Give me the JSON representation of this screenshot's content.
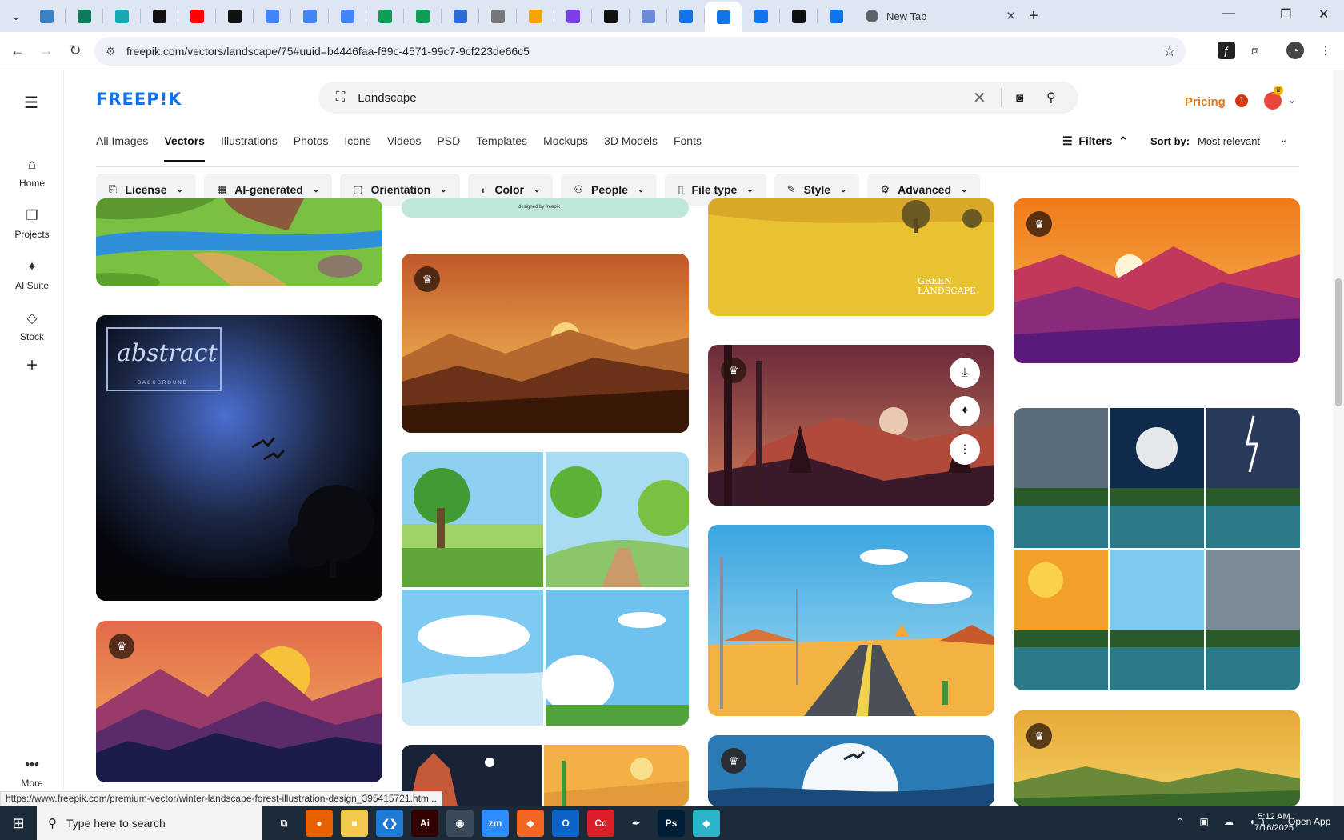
{
  "browser": {
    "tabs": [
      {
        "icon": "globe-icon",
        "color": "#3b82c4"
      },
      {
        "icon": "vpn-icon",
        "color": "#0f7a5c"
      },
      {
        "icon": "cube-icon",
        "color": "#1aa8b5"
      },
      {
        "icon": "openai-icon",
        "color": "#111111"
      },
      {
        "icon": "youtube-icon",
        "color": "#ff0000"
      },
      {
        "icon": "bolt-icon",
        "color": "#111111"
      },
      {
        "icon": "docs-icon",
        "color": "#4285f4"
      },
      {
        "icon": "docs-icon",
        "color": "#4285f4"
      },
      {
        "icon": "docs-icon",
        "color": "#4285f4"
      },
      {
        "icon": "sheets-icon",
        "color": "#0f9d58"
      },
      {
        "icon": "sheets-icon",
        "color": "#0f9d58"
      },
      {
        "icon": "word-icon",
        "color": "#2b6cd4"
      },
      {
        "icon": "globe-icon",
        "color": "#777777"
      },
      {
        "icon": "crown-icon",
        "color": "#f4a300"
      },
      {
        "icon": "brackets-icon",
        "color": "#7b3fe4"
      },
      {
        "icon": "a-icon",
        "color": "#111111"
      },
      {
        "icon": "grid-icon",
        "color": "#6a8cd8"
      },
      {
        "icon": "freepik-icon",
        "color": "#1273eb"
      },
      {
        "icon": "freepik-icon",
        "color": "#1273eb",
        "active": true
      },
      {
        "icon": "freepik-icon",
        "color": "#1273eb"
      },
      {
        "icon": "m-icon",
        "color": "#111111"
      },
      {
        "icon": "freepik-icon",
        "color": "#1273eb"
      }
    ],
    "newtab_label": "New Tab",
    "url": "freepik.com/vectors/landscape/75#uuid=b4446faa-f89c-4571-99c7-9cf223de66c5",
    "status_url": "https://www.freepik.com/premium-vector/winter-landscape-forest-illustration-design_395415721.htm..."
  },
  "rail": {
    "items": [
      {
        "label": "Home",
        "icon": "home-icon"
      },
      {
        "label": "Projects",
        "icon": "folder-icon"
      },
      {
        "label": "AI Suite",
        "icon": "sparkle-icon"
      },
      {
        "label": "Stock",
        "icon": "shapes-icon"
      }
    ],
    "more_label": "More"
  },
  "header": {
    "logo": "FREEP!K",
    "search_value": "Landscape",
    "pricing_label": "Pricing",
    "notification_count": "1"
  },
  "type_tabs": [
    "All Images",
    "Vectors",
    "Illustrations",
    "Photos",
    "Icons",
    "Videos",
    "PSD",
    "Templates",
    "Mockups",
    "3D Models",
    "Fonts"
  ],
  "active_tab": "Vectors",
  "toolbar": {
    "filters_label": "Filters",
    "sort_label": "Sort by:",
    "sort_value": "Most relevant"
  },
  "filter_chips": [
    {
      "label": "License",
      "icon": "license-icon"
    },
    {
      "label": "AI-generated",
      "icon": "ai-icon"
    },
    {
      "label": "Orientation",
      "icon": "orientation-icon"
    },
    {
      "label": "Color",
      "icon": "palette-icon"
    },
    {
      "label": "People",
      "icon": "people-icon"
    },
    {
      "label": "File type",
      "icon": "file-icon"
    },
    {
      "label": "Style",
      "icon": "brush-icon"
    },
    {
      "label": "Advanced",
      "icon": "gear-icon"
    }
  ],
  "gallery": {
    "designed_by_text": "designed by freepik",
    "green_landscape_text": "GREEN LANDSCAPE",
    "abstract_text": "abstract",
    "abstract_sub": "BACKGROUND"
  },
  "taskbar": {
    "search_placeholder": "Type here to search",
    "apps": [
      {
        "icon": "task-view-icon",
        "color": "#1c2b3a",
        "label": "⧉"
      },
      {
        "icon": "firefox-icon",
        "color": "#e66000",
        "label": "●"
      },
      {
        "icon": "explorer-icon",
        "color": "#f2c94c",
        "label": "■"
      },
      {
        "icon": "vscode-icon",
        "color": "#1f7ad4",
        "label": "❮❯"
      },
      {
        "icon": "illustrator-icon",
        "color": "#330000",
        "label": "Ai"
      },
      {
        "icon": "chrome-icon",
        "color": "#3a4a5a",
        "label": "◉",
        "active": true
      },
      {
        "icon": "zoom-icon",
        "color": "#2d8cff",
        "label": "zm"
      },
      {
        "icon": "app-orange-icon",
        "color": "#f26522",
        "label": "◈"
      },
      {
        "icon": "outlook-icon",
        "color": "#0a64c8",
        "label": "O"
      },
      {
        "icon": "creative-cloud-icon",
        "color": "#da1f26",
        "label": "Cc"
      },
      {
        "icon": "pen-icon",
        "color": "#1c2b3a",
        "label": "✒"
      },
      {
        "icon": "photoshop-icon",
        "color": "#001e36",
        "label": "Ps"
      },
      {
        "icon": "app-teal-icon",
        "color": "#2bb5c9",
        "label": "◆"
      }
    ],
    "time": "5:12 AM",
    "date": "7/16/2025",
    "open_app_label": "Open App"
  }
}
